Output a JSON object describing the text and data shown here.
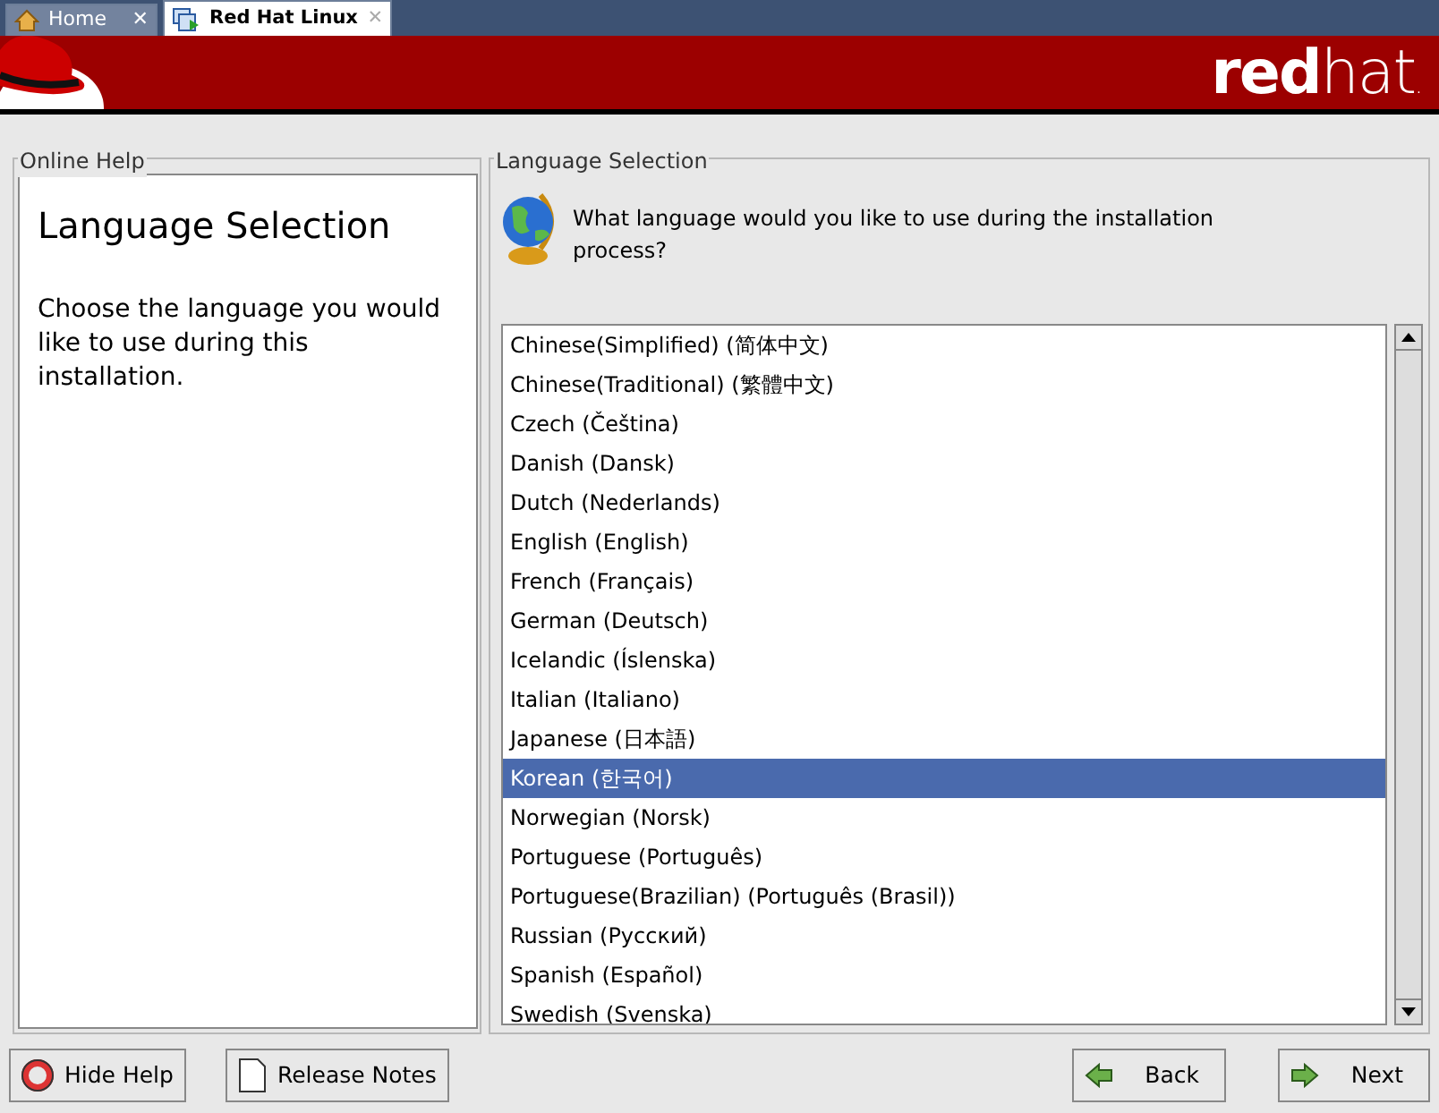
{
  "tabs": [
    {
      "label": "Home",
      "selected": false,
      "close": "✕"
    },
    {
      "label": "Red Hat Linux",
      "selected": true,
      "close": "✕"
    }
  ],
  "header": {
    "logo_bold": "red",
    "logo_light": "hat",
    "logo_dot": "."
  },
  "help_panel": {
    "title": "Online Help",
    "heading": "Language Selection",
    "text": "Choose the language you would like to use during this installation."
  },
  "language_panel": {
    "title": "Language Selection",
    "prompt": "What language would you like to use during the installation process?",
    "languages": [
      {
        "label": "Chinese(Simplified) (简体中文)",
        "selected": false
      },
      {
        "label": "Chinese(Traditional) (繁體中文)",
        "selected": false
      },
      {
        "label": "Czech (Čeština)",
        "selected": false
      },
      {
        "label": "Danish (Dansk)",
        "selected": false
      },
      {
        "label": "Dutch (Nederlands)",
        "selected": false
      },
      {
        "label": "English (English)",
        "selected": false
      },
      {
        "label": "French (Français)",
        "selected": false
      },
      {
        "label": "German (Deutsch)",
        "selected": false
      },
      {
        "label": "Icelandic (Íslenska)",
        "selected": false
      },
      {
        "label": "Italian (Italiano)",
        "selected": false
      },
      {
        "label": "Japanese (日本語)",
        "selected": false
      },
      {
        "label": "Korean (한국어)",
        "selected": true
      },
      {
        "label": "Norwegian (Norsk)",
        "selected": false
      },
      {
        "label": "Portuguese (Português)",
        "selected": false
      },
      {
        "label": "Portuguese(Brazilian) (Português (Brasil))",
        "selected": false
      },
      {
        "label": "Russian (Русский)",
        "selected": false
      },
      {
        "label": "Spanish (Español)",
        "selected": false
      },
      {
        "label": "Swedish (Svenska)",
        "selected": false
      }
    ]
  },
  "buttons": [
    {
      "label": "Hide Help",
      "kind": "help"
    },
    {
      "label": "Release Notes",
      "kind": "notes"
    },
    {
      "label": "Back",
      "kind": "back"
    },
    {
      "label": "Next",
      "kind": "next"
    }
  ]
}
